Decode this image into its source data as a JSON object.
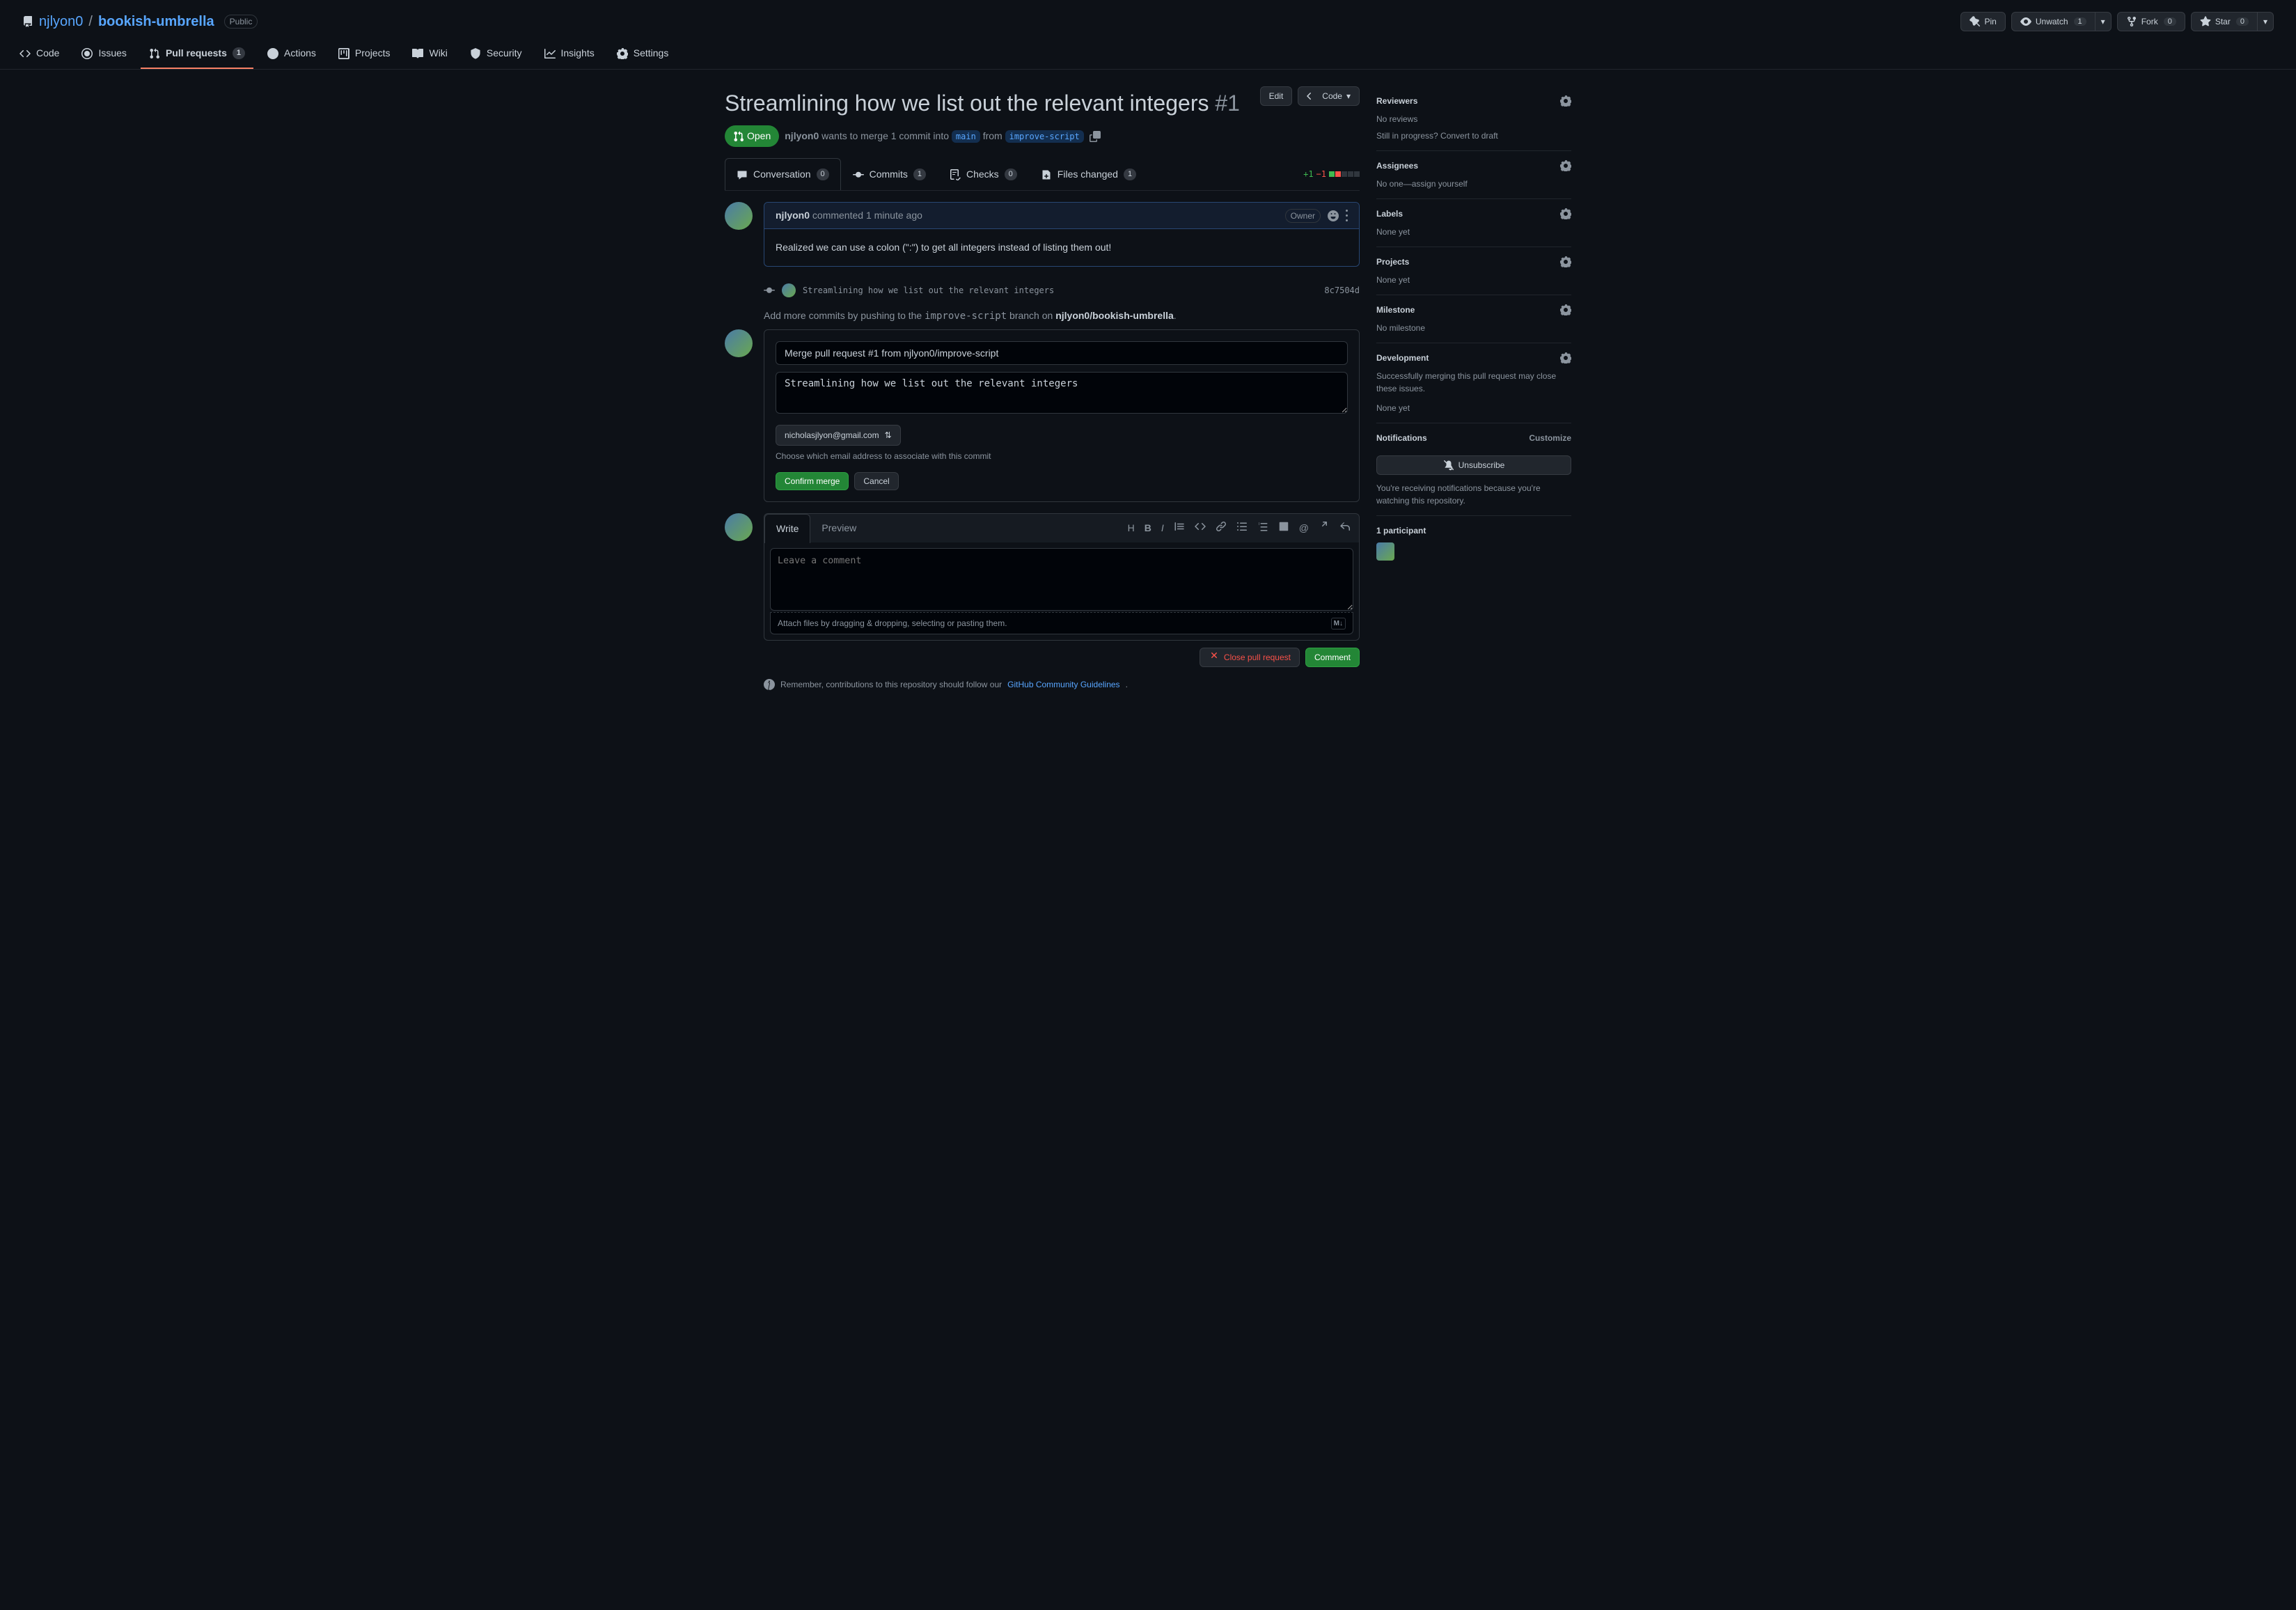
{
  "repo": {
    "owner": "njlyon0",
    "name": "bookish-umbrella",
    "visibility": "Public"
  },
  "repoActions": {
    "pin": "Pin",
    "unwatch": "Unwatch",
    "unwatch_count": "1",
    "fork": "Fork",
    "fork_count": "0",
    "star": "Star",
    "star_count": "0"
  },
  "nav": {
    "code": "Code",
    "issues": "Issues",
    "pulls": "Pull requests",
    "pulls_count": "1",
    "actions": "Actions",
    "projects": "Projects",
    "wiki": "Wiki",
    "security": "Security",
    "insights": "Insights",
    "settings": "Settings"
  },
  "pr": {
    "title": "Streamlining how we list out the relevant integers",
    "number": "#1",
    "state": "Open",
    "edit": "Edit",
    "code_btn": "Code",
    "author": "njlyon0",
    "meta_text": "wants to merge 1 commit into",
    "base": "main",
    "from_word": "from",
    "head": "improve-script"
  },
  "tabs": {
    "conversation": "Conversation",
    "conversation_count": "0",
    "commits": "Commits",
    "commits_count": "1",
    "checks": "Checks",
    "checks_count": "0",
    "files": "Files changed",
    "files_count": "1",
    "diff_add": "+1",
    "diff_del": "−1"
  },
  "comment": {
    "author": "njlyon0",
    "action": "commented",
    "time": "1 minute ago",
    "owner_badge": "Owner",
    "body": "Realized we can use a colon (\":\") to get all integers instead of listing them out!"
  },
  "commit": {
    "message": "Streamlining how we list out the relevant integers",
    "sha": "8c7504d"
  },
  "pushHint": {
    "prefix": "Add more commits by pushing to the",
    "branch": "improve-script",
    "mid": "branch on",
    "repo": "njlyon0/bookish-umbrella",
    "suffix": "."
  },
  "merge": {
    "title_value": "Merge pull request #1 from njlyon0/improve-script",
    "body_value": "Streamlining how we list out the relevant integers",
    "email": "nicholasjlyon@gmail.com",
    "email_helper": "Choose which email address to associate with this commit",
    "confirm": "Confirm merge",
    "cancel": "Cancel"
  },
  "editor": {
    "write": "Write",
    "preview": "Preview",
    "placeholder": "Leave a comment",
    "upload_hint": "Attach files by dragging & dropping, selecting or pasting them.",
    "close_pr": "Close pull request",
    "comment_btn": "Comment"
  },
  "infoBar": {
    "prefix": "Remember, contributions to this repository should follow our",
    "link": "GitHub Community Guidelines",
    "suffix": "."
  },
  "sidebar": {
    "reviewers": {
      "title": "Reviewers",
      "body": "No reviews",
      "extra": "Still in progress? ",
      "link": "Convert to draft"
    },
    "assignees": {
      "title": "Assignees",
      "body_prefix": "No one—",
      "link": "assign yourself"
    },
    "labels": {
      "title": "Labels",
      "body": "None yet"
    },
    "projects": {
      "title": "Projects",
      "body": "None yet"
    },
    "milestone": {
      "title": "Milestone",
      "body": "No milestone"
    },
    "development": {
      "title": "Development",
      "body": "Successfully merging this pull request may close these issues.",
      "body2": "None yet"
    },
    "notifications": {
      "title": "Notifications",
      "customize": "Customize",
      "unsubscribe": "Unsubscribe",
      "body": "You're receiving notifications because you're watching this repository."
    },
    "participants": {
      "title": "1 participant"
    }
  }
}
